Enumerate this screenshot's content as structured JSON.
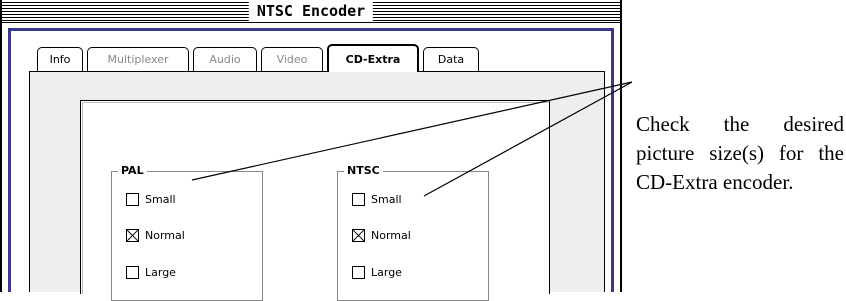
{
  "window": {
    "title": "NTSC Encoder"
  },
  "tabs": [
    {
      "label": "Info",
      "state": "enabled"
    },
    {
      "label": "Multiplexer",
      "state": "dimmed"
    },
    {
      "label": "Audio",
      "state": "dimmed"
    },
    {
      "label": "Video",
      "state": "dimmed"
    },
    {
      "label": "CD-Extra",
      "state": "active"
    },
    {
      "label": "Data",
      "state": "enabled"
    }
  ],
  "pal": {
    "legend": "PAL",
    "options": [
      {
        "label": "Small",
        "checked": false
      },
      {
        "label": "Normal",
        "checked": true
      },
      {
        "label": "Large",
        "checked": false
      }
    ]
  },
  "ntsc": {
    "legend": "NTSC",
    "options": [
      {
        "label": "Small",
        "checked": false
      },
      {
        "label": "Normal",
        "checked": true
      },
      {
        "label": "Large",
        "checked": false
      }
    ]
  },
  "annotation": {
    "text": "Check the desired picture size(s) for the CD-Extra encoder."
  }
}
